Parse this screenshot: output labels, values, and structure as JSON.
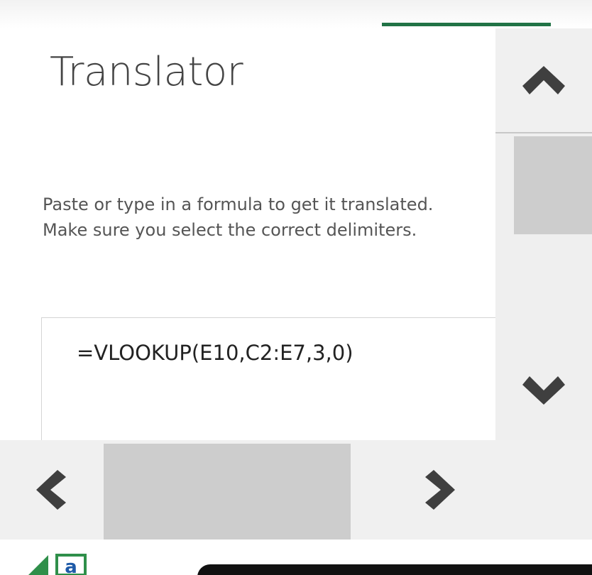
{
  "panel": {
    "title": "Translator",
    "description": "Paste or type in a formula to get it translated. Make sure you select the correct delimiters.",
    "formula_input": {
      "value": "=VLOOKUP(E10,C2:E7,3,0)"
    }
  },
  "icons": {
    "scroll_up": "chevron-up-icon",
    "scroll_down": "chevron-down-icon",
    "scroll_left": "chevron-left-icon",
    "scroll_right": "chevron-right-icon",
    "logo": "app-logo-icon"
  },
  "colors": {
    "accent": "#217346",
    "arrow": "#3f3f3f",
    "scroll_thumb": "#cdcdcd",
    "scroll_track": "#f0f0f0",
    "logo_green": "#2f8f4a",
    "logo_blue": "#1e5aa8"
  },
  "logo": {
    "letter": "a"
  }
}
